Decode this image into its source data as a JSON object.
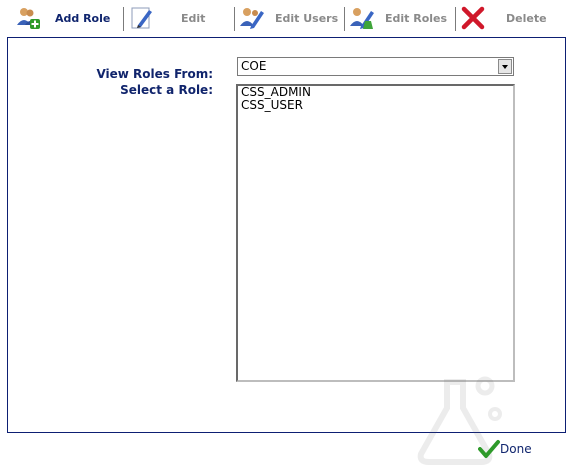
{
  "toolbar": {
    "items": [
      {
        "label": "Add Role",
        "icon": "add-user-icon",
        "enabled": true
      },
      {
        "label": "Edit",
        "icon": "pencil-icon",
        "enabled": false
      },
      {
        "label": "Edit Users",
        "icon": "edit-users-icon",
        "enabled": false
      },
      {
        "label": "Edit Roles",
        "icon": "edit-roles-icon",
        "enabled": false
      },
      {
        "label": "Delete",
        "icon": "delete-x-icon",
        "enabled": false
      }
    ]
  },
  "form": {
    "view_roles_label": "View Roles From:",
    "view_roles_value": "COE",
    "select_role_label": "Select a Role:",
    "roles": [
      "CSS_ADMIN",
      "CSS_USER"
    ]
  },
  "footer": {
    "done_label": "Done",
    "done_icon": "checkmark-icon"
  },
  "colors": {
    "accent": "#10256e",
    "disabled": "#8a8a8a",
    "delete": "#d0182a",
    "check": "#2e9a2a"
  }
}
